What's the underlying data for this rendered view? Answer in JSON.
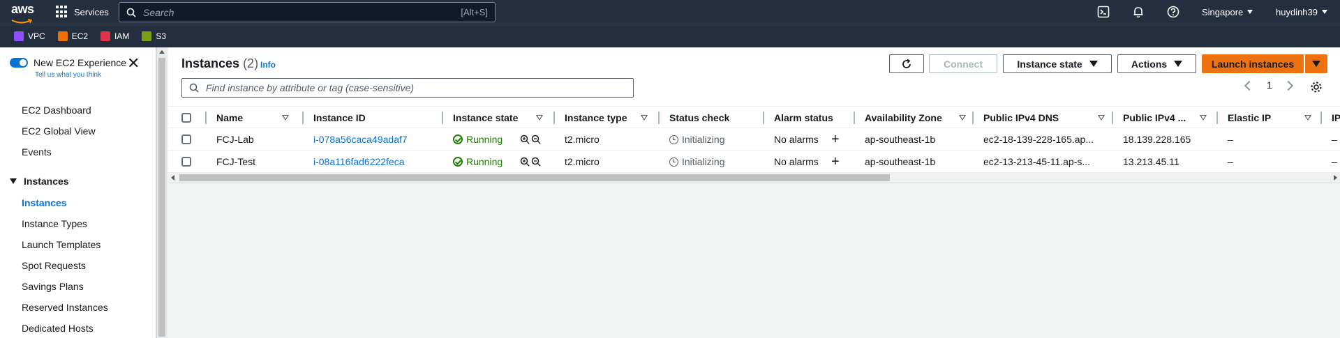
{
  "topnav": {
    "logo_text": "aws",
    "services_label": "Services",
    "search_placeholder": "Search",
    "search_shortcut": "[Alt+S]",
    "region_label": "Singapore",
    "user_label": "huydinh39"
  },
  "favorites": [
    {
      "label": "VPC",
      "color": "#8c4fff"
    },
    {
      "label": "EC2",
      "color": "#ed7100"
    },
    {
      "label": "IAM",
      "color": "#dd344c"
    },
    {
      "label": "S3",
      "color": "#7aa116"
    }
  ],
  "sidebar": {
    "experience_title": "New EC2 Experience",
    "experience_sub": "Tell us what you think",
    "links_top": [
      "EC2 Dashboard",
      "EC2 Global View",
      "Events"
    ],
    "section_title": "Instances",
    "section_items": [
      "Instances",
      "Instance Types",
      "Launch Templates",
      "Spot Requests",
      "Savings Plans",
      "Reserved Instances",
      "Dedicated Hosts"
    ],
    "active_item": "Instances"
  },
  "header": {
    "title": "Instances",
    "count": "(2)",
    "info_label": "Info",
    "connect_label": "Connect",
    "instance_state_label": "Instance state",
    "actions_label": "Actions",
    "launch_label": "Launch instances",
    "find_placeholder": "Find instance by attribute or tag (case-sensitive)",
    "page_number": "1"
  },
  "table": {
    "columns": [
      "Name",
      "Instance ID",
      "Instance state",
      "Instance type",
      "Status check",
      "Alarm status",
      "Availability Zone",
      "Public IPv4 DNS",
      "Public IPv4 ...",
      "Elastic IP",
      "IP"
    ],
    "rows": [
      {
        "name": "FCJ-Lab",
        "instance_id": "i-078a56caca49adaf7",
        "state": "Running",
        "type": "t2.micro",
        "status_check": "Initializing",
        "alarm": "No alarms",
        "az": "ap-southeast-1b",
        "dns": "ec2-18-139-228-165.ap...",
        "ipv4": "18.139.228.165",
        "elastic_ip": "–",
        "ip": "–"
      },
      {
        "name": "FCJ-Test",
        "instance_id": "i-08a116fad6222feca",
        "state": "Running",
        "type": "t2.micro",
        "status_check": "Initializing",
        "alarm": "No alarms",
        "az": "ap-southeast-1b",
        "dns": "ec2-13-213-45-11.ap-s...",
        "ipv4": "13.213.45.11",
        "elastic_ip": "–",
        "ip": "–"
      }
    ]
  },
  "colors": {
    "nav_bg": "#232f3e",
    "accent": "#0972d3",
    "launch_orange": "#ec7211",
    "running_green": "#1d8102"
  }
}
